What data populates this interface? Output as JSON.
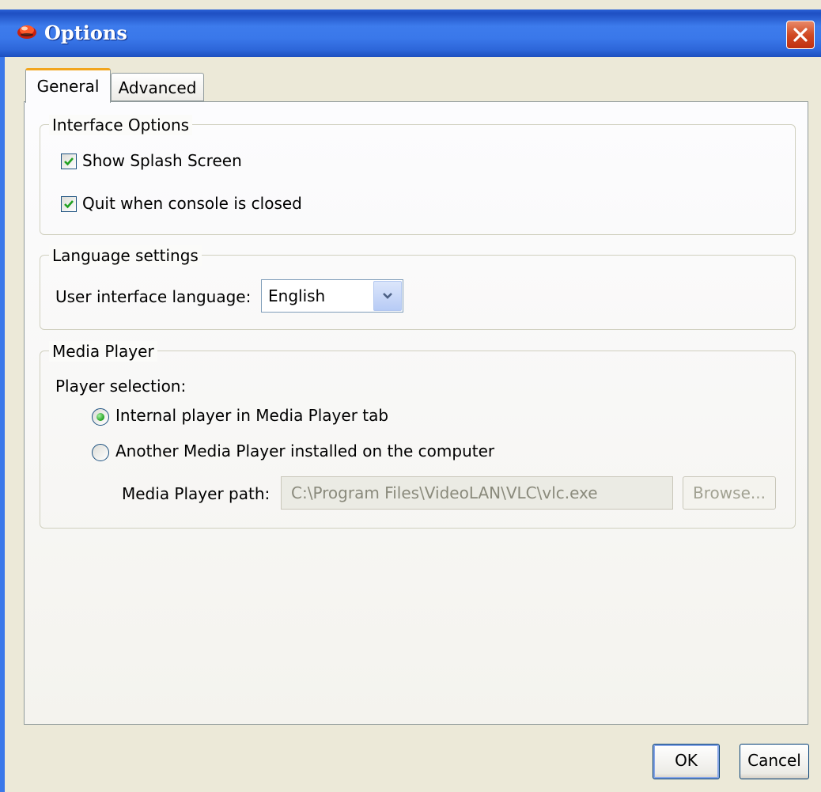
{
  "window": {
    "title": "Options"
  },
  "tabs": [
    {
      "label": "General",
      "active": true
    },
    {
      "label": "Advanced",
      "active": false
    }
  ],
  "interface_options": {
    "title": "Interface Options",
    "show_splash": {
      "label": "Show Splash Screen",
      "checked": true
    },
    "quit_on_close": {
      "label": "Quit when console is closed",
      "checked": true
    }
  },
  "language": {
    "title": "Language settings",
    "label": "User interface language:",
    "selected": "English"
  },
  "media_player": {
    "title": "Media Player",
    "selection_label": "Player selection:",
    "internal": {
      "label": "Internal player in Media Player tab",
      "selected": true
    },
    "external": {
      "label": "Another Media Player installed on the computer",
      "selected": false
    },
    "path_label": "Media Player path:",
    "path_value": "C:\\Program Files\\VideoLAN\\VLC\\vlc.exe",
    "browse_label": "Browse..."
  },
  "buttons": {
    "ok": "OK",
    "cancel": "Cancel"
  },
  "colors": {
    "titlebar": "#3a78ea",
    "tab_highlight": "#f2a51e",
    "check": "#21a121"
  }
}
